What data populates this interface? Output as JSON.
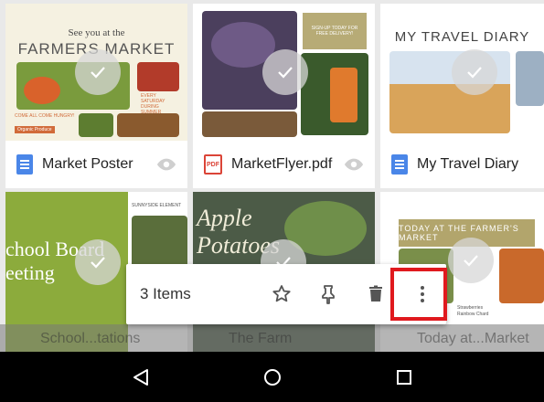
{
  "cards": [
    {
      "name": "Market Poster",
      "type": "doc",
      "thumb_line1": "See you at the",
      "thumb_line2": "FARMERS MARKET",
      "thumb_small": "COME ALL COME HUNGRY!",
      "thumb_tag": "Organic Produce",
      "thumb_note": "EVERY SATURDAY DURING SUMMER"
    },
    {
      "name": "MarketFlyer.pdf",
      "type": "pdf",
      "thumb_label": "SIGN-UP TODAY FOR FREE DELIVERY!"
    },
    {
      "name": "My Travel Diary",
      "type": "doc",
      "thumb_title": "MY TRAVEL DIARY"
    },
    {
      "name": "School...tations",
      "type": "doc",
      "thumb_text": "chool Board eeting",
      "thumb_caption": "SUNNYSIDE ELEMENT"
    },
    {
      "name": "The Farm",
      "type": "doc",
      "thumb_text": "Apple Potatoes"
    },
    {
      "name": "Today at...Market",
      "type": "doc",
      "thumb_title": "TODAY AT THE FARMER'S MARKET",
      "thumb_caption": "Strawberries Rainbow Chard"
    }
  ],
  "actionbar": {
    "count_label": "3 Items"
  },
  "icons": {
    "star": "star-icon",
    "pin": "pin-icon",
    "trash": "trash-icon",
    "more": "more-vert-icon"
  },
  "navbar": {
    "back": "back-icon",
    "home": "home-icon",
    "recents": "recents-icon"
  },
  "colors": {
    "doc_blue": "#4a86e8",
    "pdf_red": "#db4437",
    "highlight": "#e0191e"
  }
}
